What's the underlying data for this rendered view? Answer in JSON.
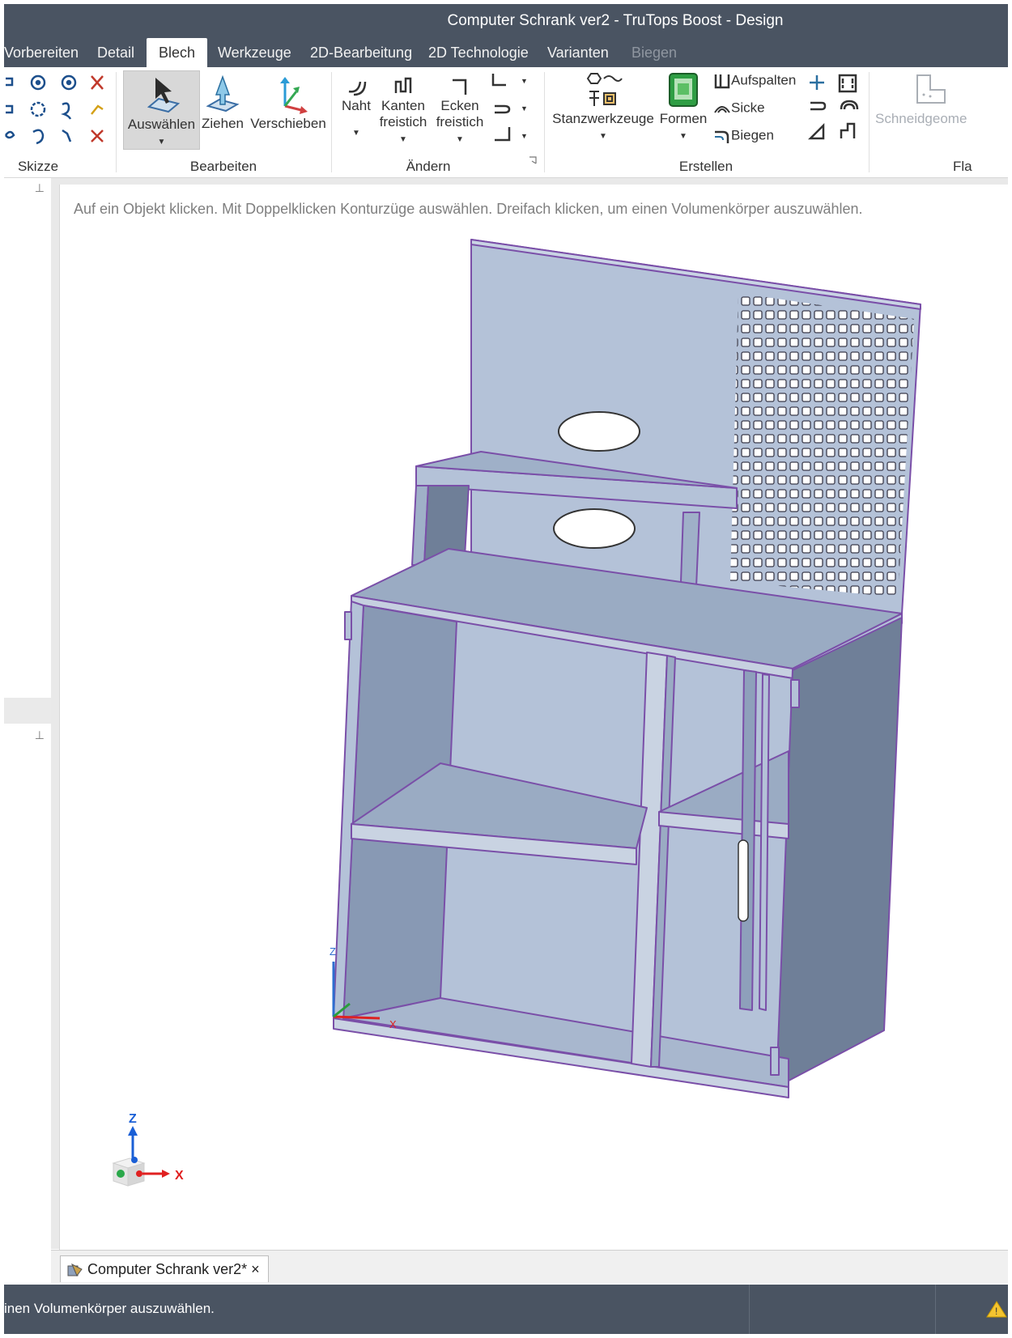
{
  "window": {
    "title": "Computer Schrank ver2 - TruTops Boost - Design"
  },
  "tabs": [
    {
      "label": "Vorbereiten"
    },
    {
      "label": "Detail"
    },
    {
      "label": "Blech",
      "active": true
    },
    {
      "label": "Werkzeuge"
    },
    {
      "label": "2D-Bearbeitung"
    },
    {
      "label": "2D Technologie"
    },
    {
      "label": "Varianten"
    },
    {
      "label": "Biegen",
      "disabled": true
    }
  ],
  "ribbon": {
    "groups": {
      "skizze": "Skizze",
      "bearbeiten": "Bearbeiten",
      "aendern": "Ändern",
      "erstellen": "Erstellen",
      "fla": "Fla"
    },
    "buttons": {
      "auswaehlen": "Auswählen",
      "ziehen": "Ziehen",
      "verschieben": "Verschieben",
      "naht": "Naht",
      "kanten_1": "Kanten",
      "kanten_2": "freistich",
      "ecken_1": "Ecken",
      "ecken_2": "freistich",
      "stanzwerkzeuge": "Stanzwerkzeuge",
      "formen": "Formen",
      "aufspalten": "Aufspalten",
      "sicke": "Sicke",
      "biegen": "Biegen",
      "schneidgeome": "Schneidgeome"
    }
  },
  "viewport": {
    "hint": "Auf ein Objekt klicken. Mit Doppelklicken Konturzüge auswählen. Dreifach klicken, um einen Volumenkörper auszuwählen.",
    "axis_z": "Z",
    "axis_x": "X"
  },
  "document_tab": {
    "label": "Computer Schrank ver2*",
    "close": "×"
  },
  "status": {
    "text": "inen Volumenkörper auszuwählen."
  },
  "colors": {
    "chrome": "#4a5462",
    "model_face": "#b4c2d8",
    "model_edge": "#7a4fa8",
    "selected_button": "#d8d8d8"
  }
}
